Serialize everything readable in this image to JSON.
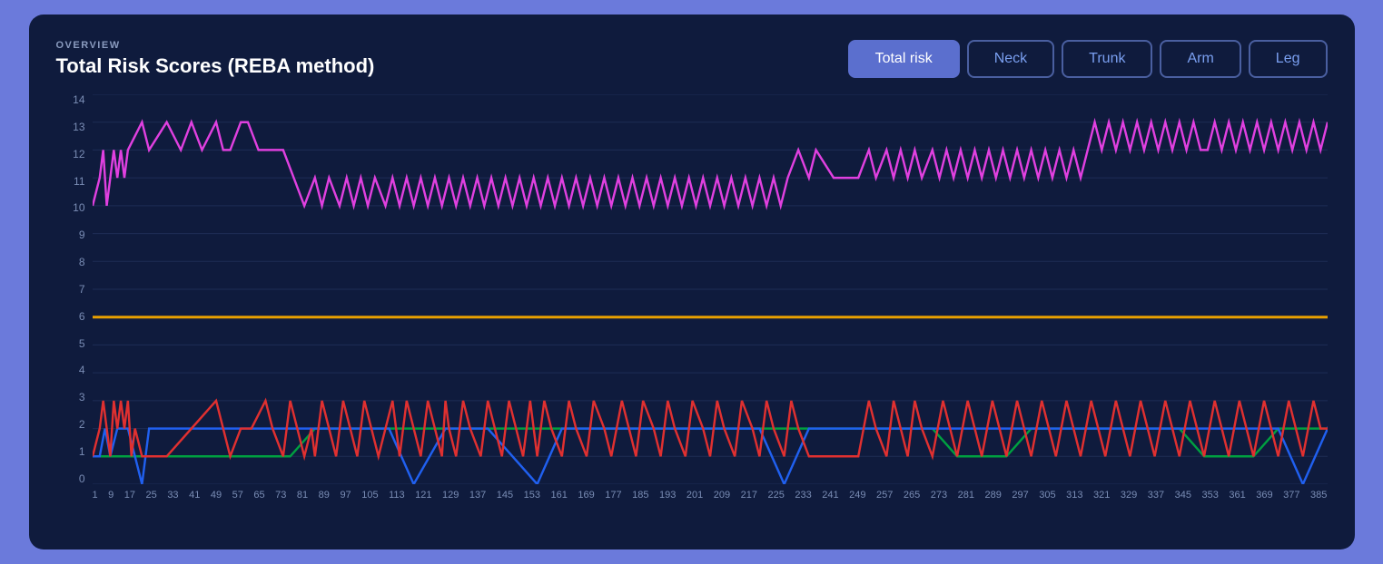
{
  "header": {
    "overline": "OVERVIEW",
    "title": "Total Risk Scores (REBA method)"
  },
  "buttons": [
    {
      "label": "Total risk",
      "active": true
    },
    {
      "label": "Neck",
      "active": false
    },
    {
      "label": "Trunk",
      "active": false
    },
    {
      "label": "Arm",
      "active": false
    },
    {
      "label": "Leg",
      "active": false
    }
  ],
  "yAxis": {
    "labels": [
      "0",
      "1",
      "2",
      "3",
      "4",
      "5",
      "6",
      "7",
      "8",
      "9",
      "10",
      "11",
      "12",
      "13",
      "14"
    ]
  },
  "xAxis": {
    "labels": [
      "1",
      "9",
      "17",
      "25",
      "33",
      "41",
      "49",
      "57",
      "65",
      "73",
      "81",
      "89",
      "97",
      "105",
      "113",
      "121",
      "129",
      "137",
      "145",
      "153",
      "161",
      "169",
      "177",
      "185",
      "193",
      "201",
      "209",
      "217",
      "225",
      "233",
      "241",
      "249",
      "257",
      "265",
      "273",
      "281",
      "289",
      "297",
      "305",
      "313",
      "321",
      "329",
      "337",
      "345",
      "353",
      "361",
      "369",
      "377",
      "385"
    ]
  },
  "colors": {
    "magenta": "#e040e0",
    "orange": "#e8a000",
    "red": "#e03030",
    "blue": "#2060f0",
    "green": "#00a040"
  }
}
